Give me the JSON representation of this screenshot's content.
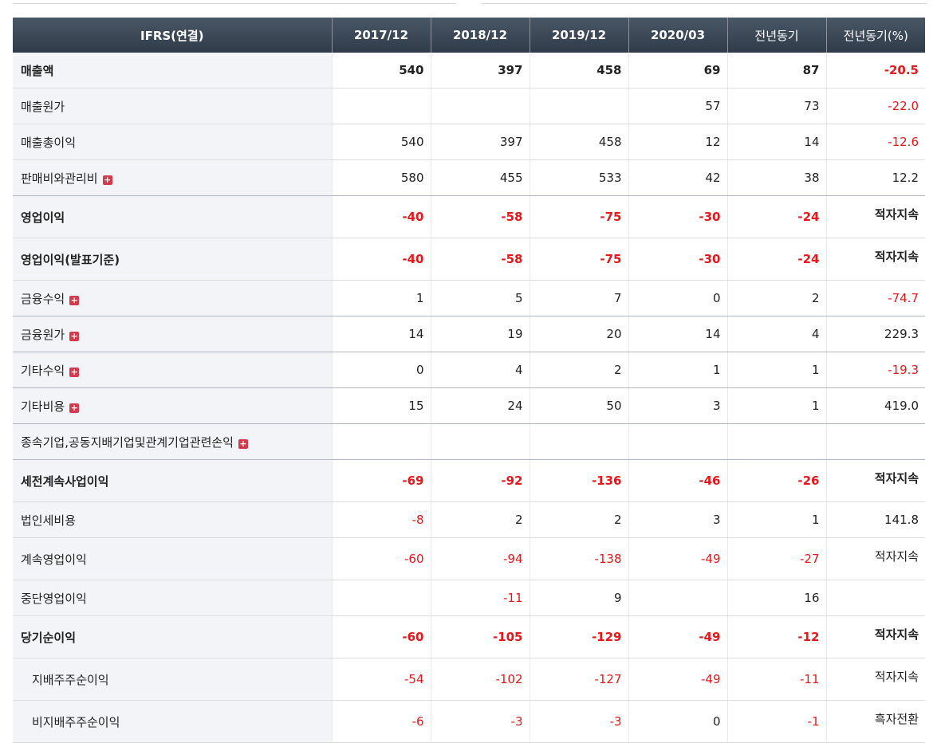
{
  "headers": [
    "IFRS(연결)",
    "2017/12",
    "2018/12",
    "2019/12",
    "2020/03",
    "전년동기",
    "전년동기(%)"
  ],
  "rows": [
    {
      "label": "매출액",
      "bold": true,
      "expand": false,
      "sub": false,
      "sep": false,
      "values": [
        "540",
        "397",
        "458",
        "69",
        "87",
        "-20.5"
      ]
    },
    {
      "label": "매출원가",
      "bold": false,
      "expand": false,
      "sub": false,
      "sep": false,
      "values": [
        "",
        "",
        "",
        "57",
        "73",
        "-22.0"
      ]
    },
    {
      "label": "매출총이익",
      "bold": false,
      "expand": false,
      "sub": false,
      "sep": false,
      "values": [
        "540",
        "397",
        "458",
        "12",
        "14",
        "-12.6"
      ]
    },
    {
      "label": "판매비와관리비",
      "bold": false,
      "expand": true,
      "sub": false,
      "sep": true,
      "values": [
        "580",
        "455",
        "533",
        "42",
        "38",
        "12.2"
      ]
    },
    {
      "label": "영업이익",
      "bold": true,
      "expand": false,
      "sub": false,
      "sep": false,
      "values": [
        "-40",
        "-58",
        "-75",
        "-30",
        "-24",
        "적자지속"
      ]
    },
    {
      "label": "영업이익(발표기준)",
      "bold": true,
      "expand": false,
      "sub": false,
      "sep": false,
      "values": [
        "-40",
        "-58",
        "-75",
        "-30",
        "-24",
        "적자지속"
      ]
    },
    {
      "label": "금융수익",
      "bold": false,
      "expand": true,
      "sub": false,
      "sep": true,
      "values": [
        "1",
        "5",
        "7",
        "0",
        "2",
        "-74.7"
      ]
    },
    {
      "label": "금융원가",
      "bold": false,
      "expand": true,
      "sub": false,
      "sep": true,
      "values": [
        "14",
        "19",
        "20",
        "14",
        "4",
        "229.3"
      ]
    },
    {
      "label": "기타수익",
      "bold": false,
      "expand": true,
      "sub": false,
      "sep": true,
      "values": [
        "0",
        "4",
        "2",
        "1",
        "1",
        "-19.3"
      ]
    },
    {
      "label": "기타비용",
      "bold": false,
      "expand": true,
      "sub": false,
      "sep": true,
      "values": [
        "15",
        "24",
        "50",
        "3",
        "1",
        "419.0"
      ]
    },
    {
      "label": "종속기업,공동지배기업및관계기업관련손익",
      "bold": false,
      "expand": true,
      "sub": false,
      "sep": true,
      "values": [
        "",
        "",
        "",
        "",
        "",
        ""
      ]
    },
    {
      "label": "세전계속사업이익",
      "bold": true,
      "expand": false,
      "sub": false,
      "sep": false,
      "values": [
        "-69",
        "-92",
        "-136",
        "-46",
        "-26",
        "적자지속"
      ]
    },
    {
      "label": "법인세비용",
      "bold": false,
      "expand": false,
      "sub": false,
      "sep": false,
      "values": [
        "-8",
        "2",
        "2",
        "3",
        "1",
        "141.8"
      ]
    },
    {
      "label": "계속영업이익",
      "bold": false,
      "expand": false,
      "sub": false,
      "sep": false,
      "values": [
        "-60",
        "-94",
        "-138",
        "-49",
        "-27",
        "적자지속"
      ]
    },
    {
      "label": "중단영업이익",
      "bold": false,
      "expand": false,
      "sub": false,
      "sep": false,
      "values": [
        "",
        "-11",
        "9",
        "",
        "16",
        ""
      ]
    },
    {
      "label": "당기순이익",
      "bold": true,
      "expand": false,
      "sub": false,
      "sep": false,
      "values": [
        "-60",
        "-105",
        "-129",
        "-49",
        "-12",
        "적자지속"
      ]
    },
    {
      "label": "지배주주순이익",
      "bold": false,
      "expand": false,
      "sub": true,
      "sep": false,
      "values": [
        "-54",
        "-102",
        "-127",
        "-49",
        "-11",
        "적자지속"
      ]
    },
    {
      "label": "비지배주주순이익",
      "bold": false,
      "expand": false,
      "sub": true,
      "sep": false,
      "values": [
        "-6",
        "-3",
        "-3",
        "0",
        "-1",
        "흑자전환"
      ]
    }
  ],
  "colors": {
    "negative": "#e8171c",
    "header_bg": "#3a4655",
    "label_bg": "#f2f4f7",
    "expand_icon": "#d33a4b"
  },
  "icons": {
    "expand": "plus-square-icon"
  }
}
